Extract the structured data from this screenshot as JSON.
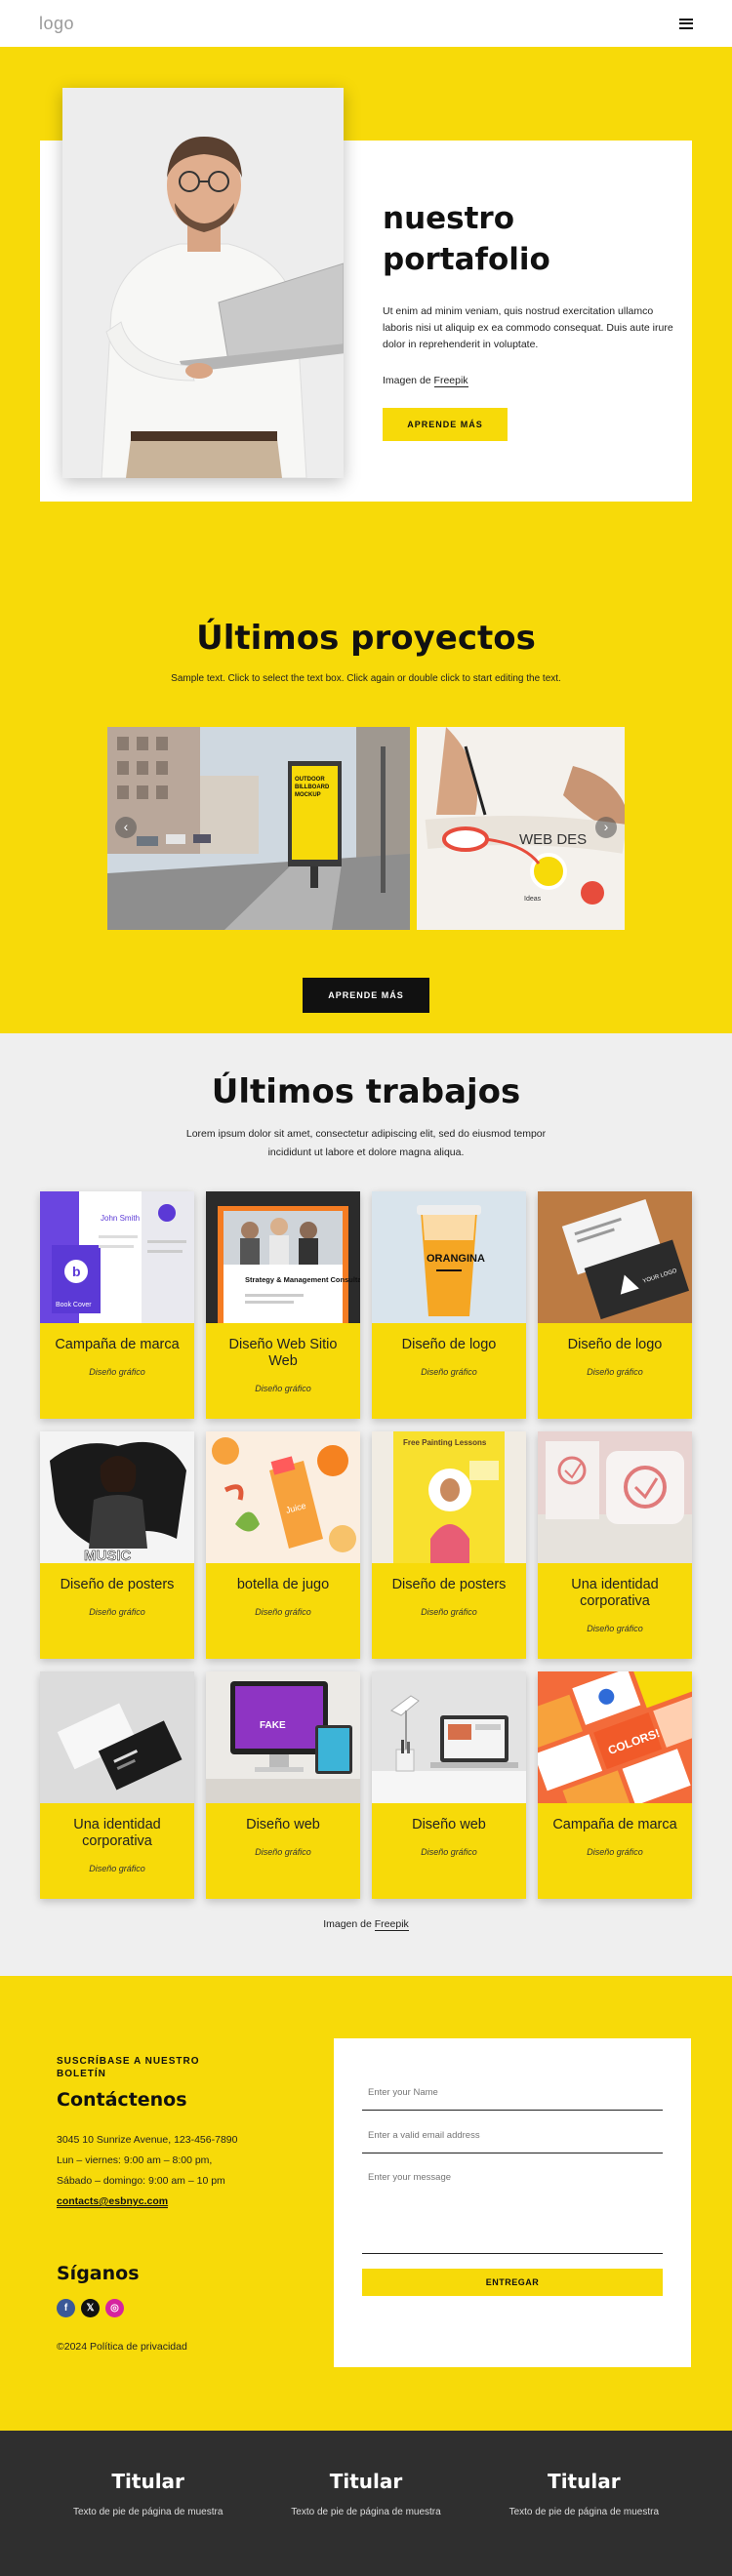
{
  "header": {
    "logo": "logo",
    "menu_icon": "hamburger-menu-icon"
  },
  "hero": {
    "title_line1": "nuestro",
    "title_line2": "portafolio",
    "description": "Ut enim ad minim veniam, quis nostrud exercitation ullamco laboris nisi ut aliquip ex ea commodo consequat. Duis aute irure dolor in reprehenderit in voluptate.",
    "credit_prefix": "Imagen de",
    "credit_link": "Freepik",
    "button": "APRENDE MÁS"
  },
  "projects": {
    "title": "Últimos proyectos",
    "subtitle": "Sample text. Click to select the text box. Click again or double click to start editing the text.",
    "slide1_text": [
      "OUTDOOR",
      "BILLBOARD",
      "MOCKUP"
    ],
    "slide2_text": "WEB DES",
    "slide2_labels": [
      "Ideas"
    ],
    "button": "APRENDE MÁS"
  },
  "works": {
    "title": "Últimos trabajos",
    "subtitle": "Lorem ipsum dolor sit amet, consectetur adipiscing elit, sed do eiusmod tempor incididunt ut labore et dolore magna aliqua.",
    "cards": [
      {
        "title": "Campaña de marca",
        "category": "Diseño gráfico",
        "img_text": "John Smith",
        "img_caption": "Book Cover"
      },
      {
        "title": "Diseño Web Sitio Web",
        "category": "Diseño gráfico",
        "img_text": "Strategy & Management Consultancy"
      },
      {
        "title": "Diseño de logo",
        "category": "Diseño gráfico",
        "img_text": "ORANGINA"
      },
      {
        "title": "Diseño de logo",
        "category": "Diseño gráfico",
        "img_text": "YOUR LOGO"
      },
      {
        "title": "Diseño de posters",
        "category": "Diseño gráfico",
        "img_text": "MUSIC"
      },
      {
        "title": "botella de jugo",
        "category": "Diseño gráfico",
        "img_text": "Juice"
      },
      {
        "title": "Diseño de posters",
        "category": "Diseño gráfico",
        "img_text": "Free Painting Lessons"
      },
      {
        "title": "Una identidad corporativa",
        "category": "Diseño gráfico",
        "img_text": ""
      },
      {
        "title": "Una identidad corporativa",
        "category": "Diseño gráfico",
        "img_text": ""
      },
      {
        "title": "Diseño web",
        "category": "Diseño gráfico",
        "img_text": "FAKE"
      },
      {
        "title": "Diseño web",
        "category": "Diseño gráfico",
        "img_text": ""
      },
      {
        "title": "Campaña de marca",
        "category": "Diseño gráfico",
        "img_text": "COLORS!"
      }
    ],
    "credit_prefix": "Imagen de",
    "credit_link": "Freepik"
  },
  "contact": {
    "newsletter": "SUSCRÍBASE A NUESTRO BOLETÍN",
    "title": "Contáctenos",
    "address": "3045 10 Sunrize Avenue, 123-456-7890",
    "hours1": "Lun – viernes: 9:00 am – 8:00 pm,",
    "hours2": "Sábado – domingo: 9:00 am – 10 pm",
    "email": "contacts@esbnyc.com",
    "follow_title": "Síganos",
    "socials": [
      {
        "name": "facebook-icon",
        "glyph": "f",
        "color": "#3b5998"
      },
      {
        "name": "x-icon",
        "glyph": "𝕏",
        "color": "#111111"
      },
      {
        "name": "instagram-icon",
        "glyph": "◎",
        "color": "#d6249f"
      }
    ],
    "copyright": "©2024 Política de privacidad",
    "form": {
      "name_placeholder": "Enter your Name",
      "email_placeholder": "Enter a valid email address",
      "message_placeholder": "Enter your message",
      "submit": "ENTREGAR"
    }
  },
  "footer": {
    "columns": [
      {
        "title": "Titular",
        "text": "Texto de pie de página de muestra"
      },
      {
        "title": "Titular",
        "text": "Texto de pie de página de muestra"
      },
      {
        "title": "Titular",
        "text": "Texto de pie de página de muestra"
      }
    ]
  },
  "colors": {
    "accent": "#f7da09",
    "dark": "#111111",
    "footer": "#2f2f2f",
    "works_bg": "#efefef"
  }
}
